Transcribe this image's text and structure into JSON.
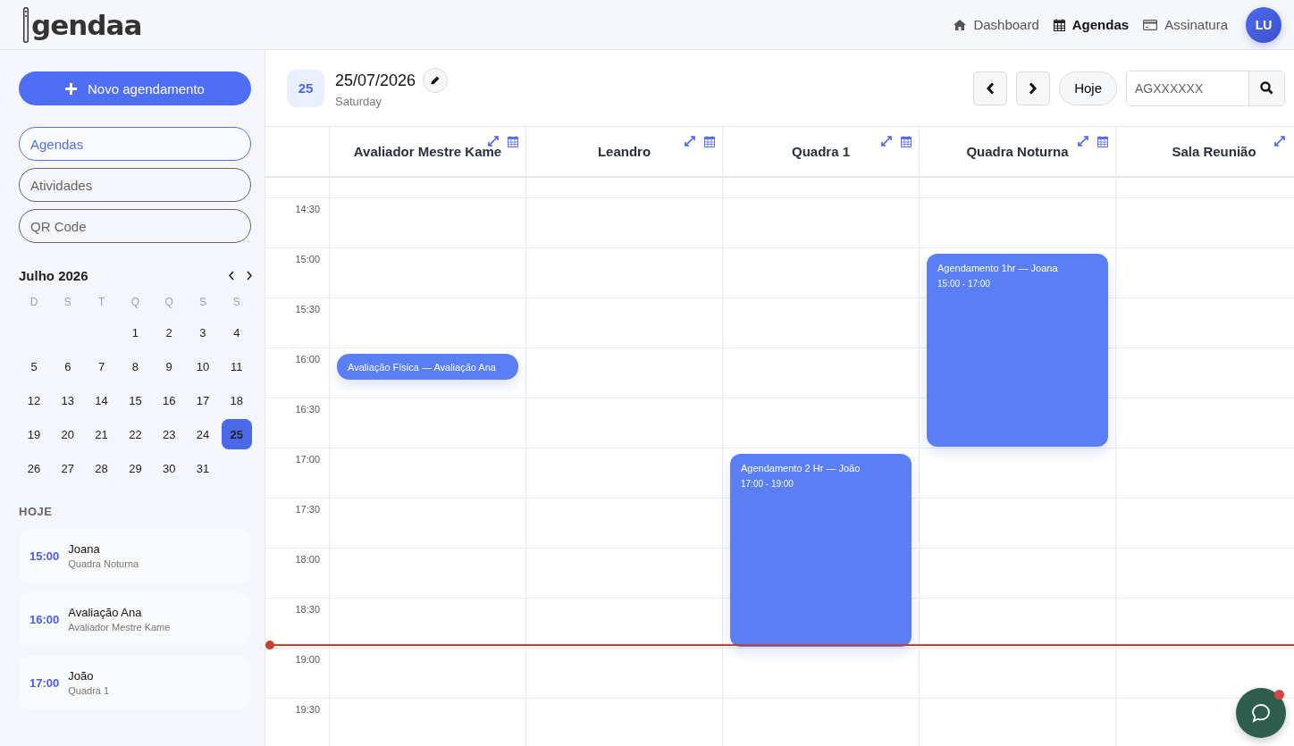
{
  "header": {
    "logo": "gendaa",
    "nav": [
      {
        "kind": "home",
        "label": "Dashboard",
        "selected": false
      },
      {
        "kind": "calendar",
        "label": "Agendas",
        "selected": true
      },
      {
        "kind": "card",
        "label": "Assinatura",
        "selected": false
      }
    ],
    "avatar": "LU"
  },
  "sidebar": {
    "new_button": "Novo agendamento",
    "menu": [
      {
        "label": "Agendas",
        "selected": true
      },
      {
        "label": "Atividades",
        "selected": false
      },
      {
        "label": "QR Code",
        "selected": false
      }
    ],
    "mini_calendar": {
      "month": "Julho 2026",
      "weekdays": [
        "D",
        "S",
        "T",
        "Q",
        "Q",
        "S",
        "S"
      ],
      "weeks": [
        {
          "kind": "leading_blanks",
          "days": [
            {
              "label": "1",
              "selected": false
            },
            {
              "label": "2",
              "selected": false
            },
            {
              "label": "3",
              "selected": false
            },
            {
              "label": "4",
              "selected": false
            }
          ]
        },
        {
          "kind": "full",
          "days": [
            {
              "label": "5",
              "selected": false
            },
            {
              "label": "6",
              "selected": false
            },
            {
              "label": "7",
              "selected": false
            },
            {
              "label": "8",
              "selected": false
            },
            {
              "label": "9",
              "selected": false
            },
            {
              "label": "10",
              "selected": false
            },
            {
              "label": "11",
              "selected": false
            }
          ]
        },
        {
          "kind": "full",
          "days": [
            {
              "label": "12",
              "selected": false
            },
            {
              "label": "13",
              "selected": false
            },
            {
              "label": "14",
              "selected": false
            },
            {
              "label": "15",
              "selected": false
            },
            {
              "label": "16",
              "selected": false
            },
            {
              "label": "17",
              "selected": false
            },
            {
              "label": "18",
              "selected": false
            }
          ]
        },
        {
          "kind": "full",
          "days": [
            {
              "label": "19",
              "selected": false
            },
            {
              "label": "20",
              "selected": false
            },
            {
              "label": "21",
              "selected": false
            },
            {
              "label": "22",
              "selected": false
            },
            {
              "label": "23",
              "selected": false
            },
            {
              "label": "24",
              "selected": false
            },
            {
              "label": "25",
              "selected": true
            }
          ]
        },
        {
          "kind": "trailing_blanks",
          "days": [
            {
              "label": "26",
              "selected": false
            },
            {
              "label": "27",
              "selected": false
            },
            {
              "label": "28",
              "selected": false
            },
            {
              "label": "29",
              "selected": false
            },
            {
              "label": "30",
              "selected": false
            },
            {
              "label": "31",
              "selected": false
            }
          ]
        }
      ]
    },
    "today_title": "HOJE",
    "today": [
      {
        "time": "15:00",
        "name": "Joana",
        "place": "Quadra Noturna"
      },
      {
        "time": "16:00",
        "name": "Avaliação Ana",
        "place": "Avaliador Mestre Kame"
      },
      {
        "time": "17:00",
        "name": "João",
        "place": "Quadra 1"
      }
    ]
  },
  "toolbar": {
    "day_badge": "25",
    "date": "25/07/2026",
    "weekday": "Saturday",
    "today_button": "Hoje",
    "search": {
      "placeholder": "AGXXXXXX"
    }
  },
  "schedule": {
    "resources": [
      "Avaliador Mestre Kame",
      "Leandro",
      "Quadra 1",
      "Quadra Noturna",
      "Sala Reunião"
    ],
    "rows": [
      {
        "time": "14:30",
        "now": false
      },
      {
        "time": "15:00",
        "now": false,
        "cells": [
          {
            "kind": "empty"
          },
          {
            "kind": "empty"
          },
          {
            "kind": "empty"
          },
          {
            "kind": "block",
            "title": "Agendamento 1hr — Joana",
            "time": "15:00 - 17:00"
          },
          {
            "kind": "empty"
          }
        ]
      },
      {
        "time": "15:30",
        "now": false
      },
      {
        "time": "16:00",
        "now": false,
        "cells": [
          {
            "kind": "compact",
            "title": "Avaliação Física — Avaliação Ana"
          },
          {
            "kind": "empty"
          },
          {
            "kind": "empty"
          },
          {
            "kind": "empty"
          },
          {
            "kind": "empty"
          }
        ]
      },
      {
        "time": "16:30",
        "now": false
      },
      {
        "time": "17:00",
        "now": false,
        "cells": [
          {
            "kind": "empty"
          },
          {
            "kind": "empty"
          },
          {
            "kind": "block",
            "title": "Agendamento 2 Hr — João",
            "time": "17:00 - 19:00"
          },
          {
            "kind": "empty"
          },
          {
            "kind": "empty"
          }
        ]
      },
      {
        "time": "17:30",
        "now": false
      },
      {
        "time": "18:00",
        "now": false
      },
      {
        "time": "18:30",
        "now": true
      },
      {
        "time": "19:00",
        "now": false
      },
      {
        "time": "19:30",
        "now": false
      }
    ]
  }
}
